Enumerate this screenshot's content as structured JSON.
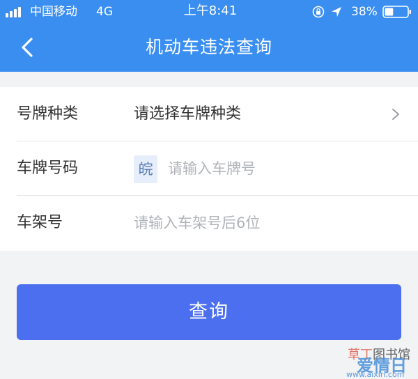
{
  "status_bar": {
    "carrier": "中国移动",
    "network": "4G",
    "time": "上午8:41",
    "battery_percent": "38%",
    "battery_level": 0.38,
    "icons": [
      "signal-icon",
      "lock-rotation-icon",
      "location-icon",
      "battery-icon"
    ]
  },
  "nav": {
    "back_icon": "chevron-left-icon",
    "title": "机动车违法查询"
  },
  "form": {
    "rows": [
      {
        "label": "号牌种类",
        "value": "请选择车牌种类",
        "trailing_icon": "chevron-right-icon"
      },
      {
        "label": "车牌号码",
        "province": "皖",
        "placeholder": "请输入车牌号"
      },
      {
        "label": "车架号",
        "placeholder": "请输入车架号后6位"
      }
    ]
  },
  "query_button": {
    "label": "查询"
  },
  "watermark": {
    "line1_part1": "草丁",
    "line1_part2": "图书馆",
    "line2": "爱情日",
    "url": "www.aixiri.com"
  },
  "colors": {
    "header": "#3a8ef0",
    "button": "#4c6ff0",
    "background": "#f2f3f5",
    "placeholder": "#b0b3b8",
    "province_chip": "#e6eefb"
  }
}
